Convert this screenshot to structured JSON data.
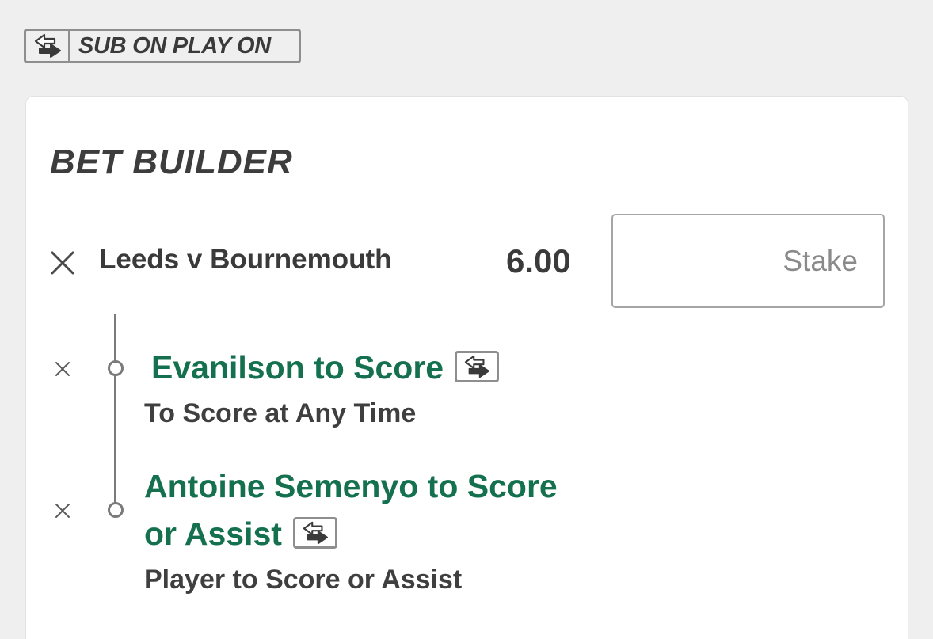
{
  "badge": {
    "label": "SUB ON PLAY ON",
    "icon": "substitution-arrows-icon"
  },
  "bet_builder": {
    "title": "BET BUILDER",
    "event": {
      "name": "Leeds v Bournemouth",
      "odds": "6.00"
    },
    "stake": {
      "placeholder": "Stake",
      "value": ""
    },
    "legs": [
      {
        "title": "Evanilson to Score",
        "market": "To Score at Any Time",
        "icon": "substitution-arrows-icon"
      },
      {
        "title_line1": "Antoine Semenyo to Score",
        "title_line2": "or Assist",
        "market": "Player to Score or Assist",
        "icon": "substitution-arrows-icon"
      }
    ]
  },
  "colors": {
    "background": "#efefef",
    "card": "#ffffff",
    "leg_title": "#14704e",
    "text": "#3a3a3a",
    "border": "#8e8e8e"
  }
}
